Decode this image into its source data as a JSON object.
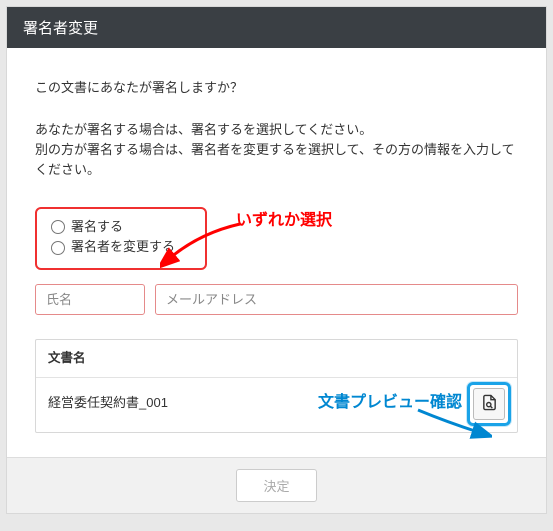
{
  "header": {
    "title": "署名者変更"
  },
  "body": {
    "question": "この文書にあなたが署名しますか？",
    "description_line1": "あなたが署名する場合は、署名するを選択してください。",
    "description_line2": "別の方が署名する場合は、署名者を変更するを選択して、その方の情報を入力してください。"
  },
  "radios": {
    "sign": "署名する",
    "change": "署名者を変更する"
  },
  "inputs": {
    "name_placeholder": "氏名",
    "email_placeholder": "メールアドレス"
  },
  "document": {
    "label": "文書名",
    "name": "経営委任契約書_001"
  },
  "footer": {
    "submit": "決定"
  },
  "annotations": {
    "select_one": "いずれか選択",
    "preview_confirm": "文書プレビュー確認"
  },
  "icons": {
    "preview": "document-preview-icon"
  }
}
